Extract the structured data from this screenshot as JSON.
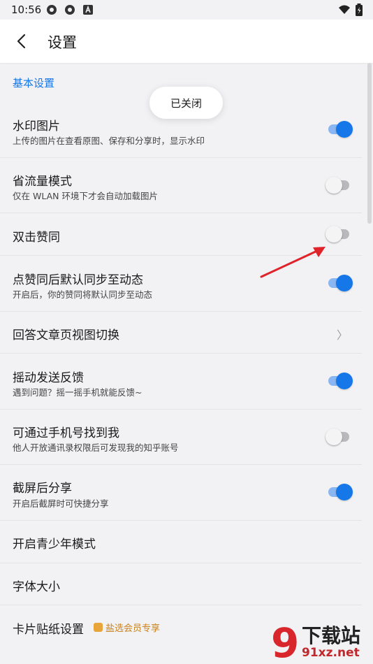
{
  "status_bar": {
    "time": "10:56",
    "icons": [
      "app-icon",
      "app-icon",
      "app-a-icon",
      "wifi-icon",
      "battery-icon"
    ]
  },
  "header": {
    "title": "设置"
  },
  "toast": {
    "text": "已关闭"
  },
  "section": {
    "title": "基本设置"
  },
  "settings": [
    {
      "title": "水印图片",
      "subtitle": "上传的图片在查看原图、保存和分享时，显示水印",
      "control": "toggle",
      "on": true
    },
    {
      "title": "省流量模式",
      "subtitle": "仅在 WLAN 环境下才会自动加载图片",
      "control": "toggle",
      "on": false
    },
    {
      "title": "双击赞同",
      "subtitle": "",
      "control": "toggle",
      "on": false
    },
    {
      "title": "点赞同后默认同步至动态",
      "subtitle": "开启后，你的赞同将默认同步至动态",
      "control": "toggle",
      "on": true
    },
    {
      "title": "回答文章页视图切换",
      "subtitle": "",
      "control": "chevron"
    },
    {
      "title": "摇动发送反馈",
      "subtitle": "遇到问题？摇一摇手机就能反馈~",
      "control": "toggle",
      "on": true
    },
    {
      "title": "可通过手机号找到我",
      "subtitle": "他人开放通讯录权限后可发现我的知乎账号",
      "control": "toggle",
      "on": false
    },
    {
      "title": "截屏后分享",
      "subtitle": "开启后截屏时可快捷分享",
      "control": "toggle",
      "on": true
    },
    {
      "title": "开启青少年模式",
      "subtitle": "",
      "control": "none"
    },
    {
      "title": "字体大小",
      "subtitle": "",
      "control": "none"
    },
    {
      "title": "卡片贴纸设置",
      "subtitle": "",
      "control": "badge",
      "badge": "盐选会员专享"
    }
  ],
  "chevron_glyph": "〉",
  "watermark": {
    "title": "下载站",
    "url": "91xz.net",
    "logo_text": "9"
  },
  "colors": {
    "accent": "#1677e8",
    "background": "#f2f2f4",
    "annotation_arrow": "#e0232a"
  }
}
